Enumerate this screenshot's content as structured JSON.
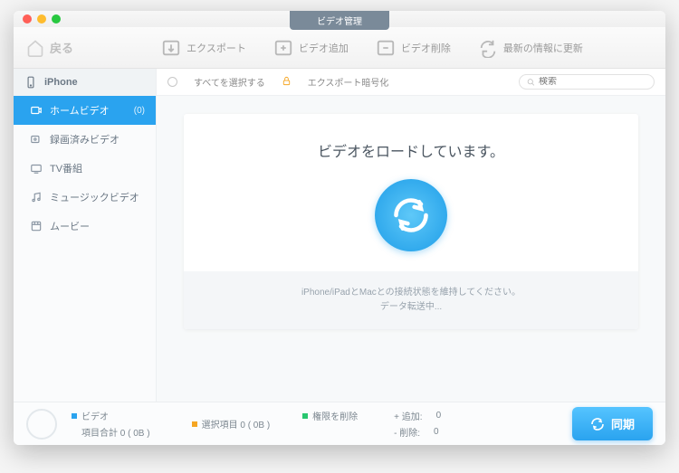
{
  "title": "ビデオ管理",
  "back": "戻る",
  "toolbar": {
    "export": "エクスポート",
    "add": "ビデオ追加",
    "del": "ビデオ削除",
    "refresh": "最新の情報に更新"
  },
  "device": "iPhone",
  "sidebar": [
    {
      "label": "ホームビデオ",
      "count": "(0)",
      "active": true
    },
    {
      "label": "録画済みビデオ"
    },
    {
      "label": "TV番組"
    },
    {
      "label": "ミュージックビデオ"
    },
    {
      "label": "ムービー"
    }
  ],
  "filter": {
    "selectall": "すべてを選択する",
    "encrypt": "エクスポート暗号化",
    "searchph": "検索"
  },
  "loading": {
    "heading": "ビデオをロードしています。",
    "line1": "iPhone/iPadとMacとの接続状態を維持してください。",
    "line2": "データ転送中..."
  },
  "footer": {
    "video": "ビデオ",
    "total": "項目合計 0 ( 0B )",
    "selected": "選択項目 0 ( 0B )",
    "perm": "権限を削除",
    "addlbl": "+ 追加:",
    "addval": "0",
    "dellbl": "- 削除:",
    "delval": "0",
    "sync": "同期"
  }
}
